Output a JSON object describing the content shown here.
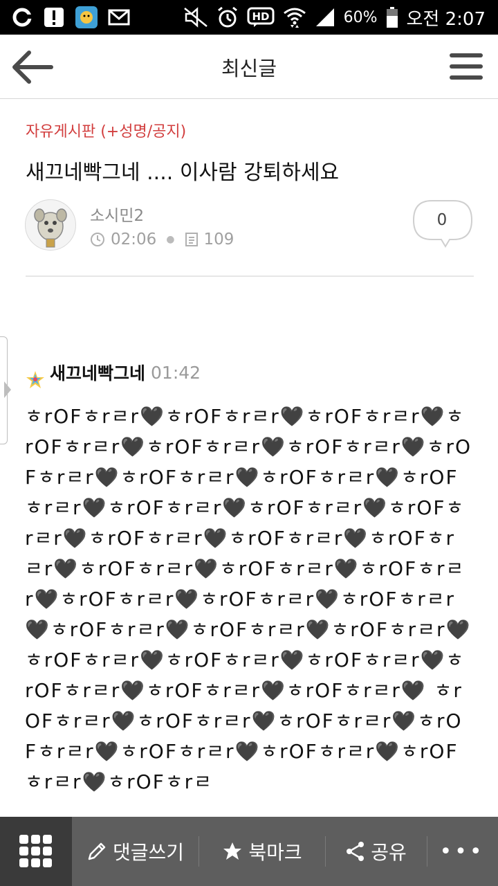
{
  "status_bar": {
    "battery_percent": "60%",
    "time": "오전 2:07",
    "icons": [
      "o-icon",
      "alert-icon",
      "app-icon",
      "mail-icon",
      "mute-icon",
      "alarm-icon",
      "hd-icon",
      "wifi-icon",
      "signal-icon",
      "battery-icon"
    ]
  },
  "app_bar": {
    "title": "최신글",
    "back_icon": "back-arrow-icon",
    "menu_icon": "menu-icon"
  },
  "article": {
    "board": "자유게시판 (+성명/공지)",
    "title": "새끄네빡그네 .... 이사람 강퇴하세요",
    "author": "소시민2",
    "time": "02:06",
    "views": "109",
    "comment_count": "0"
  },
  "post": {
    "author": "새끄네빡그네",
    "time": "01:42",
    "body": "ㅎrOFㅎrㄹr🖤ㅎrOFㅎrㄹr🖤ㅎrOFㅎrㄹr🖤ㅎrOFㅎrㄹr🖤ㅎrOFㅎrㄹr🖤ㅎrOFㅎrㄹr🖤ㅎrOFㅎrㄹr🖤ㅎrOFㅎrㄹr🖤ㅎrOFㅎrㄹr🖤ㅎrOFㅎrㄹr🖤ㅎrOFㅎrㄹr🖤ㅎrOFㅎrㄹr🖤ㅎrOFㅎrㄹr🖤ㅎrOFㅎrㄹr🖤ㅎrOFㅎrㄹr🖤ㅎrOFㅎrㄹr🖤ㅎrOFㅎrㄹr🖤ㅎrOFㅎrㄹr🖤ㅎrOFㅎrㄹr🖤ㅎrOFㅎrㄹr🖤ㅎrOFㅎrㄹr🖤ㅎrOFㅎrㄹr🖤ㅎrOFㅎrㄹr🖤ㅎrOFㅎrㄹr🖤ㅎrOFㅎrㄹr🖤ㅎrOFㅎrㄹr🖤ㅎrOFㅎrㄹr🖤ㅎrOFㅎrㄹr🖤ㅎrOFㅎrㄹr🖤ㅎrOFㅎrㄹr🖤ㅎrOFㅎrㄹr🖤 ㅎrOFㅎrㄹr🖤ㅎrOFㅎrㄹr🖤ㅎrOFㅎrㄹr🖤ㅎrOFㅎrㄹr🖤ㅎrOFㅎrㄹr🖤ㅎrOFㅎrㄹr🖤ㅎrOFㅎrㄹr🖤ㅎrOFㅎrㄹ"
  },
  "bottom_bar": {
    "comment_label": "댓글쓰기",
    "bookmark_label": "북마크",
    "share_label": "공유",
    "more_label": "•••"
  },
  "colors": {
    "board_red": "#d23e3e",
    "bottom_bar_bg": "#5e5e5e",
    "grid_btn_bg": "#3a3a3a"
  }
}
